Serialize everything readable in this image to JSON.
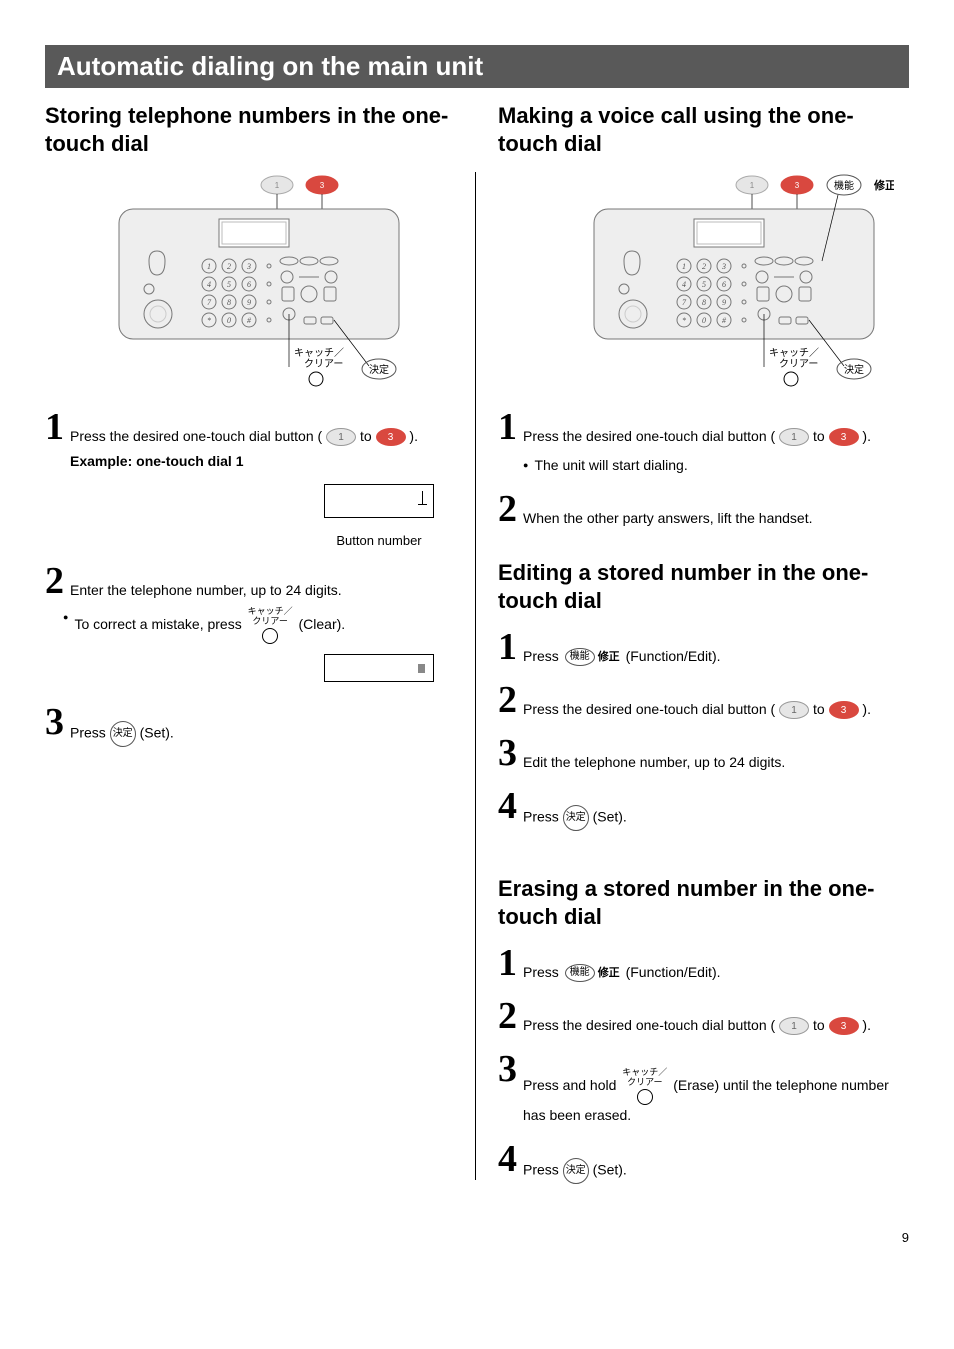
{
  "pageNumber": "9",
  "headerTitle": "Automatic dialing on the main unit",
  "left": {
    "title": "Storing telephone numbers in the one-touch dial",
    "step1": "Press the desired one-touch dial button (",
    "step1_close": ").",
    "example": "Example: one-touch dial 1",
    "displayCaption": "Button number",
    "step2": "Enter the telephone number, up to 24 digits.",
    "correct": "To correct a mistake, press",
    "correctAfter": "(Clear).",
    "step3": "Press",
    "setLabel": "(Set).",
    "to": "to"
  },
  "right": {
    "making": {
      "title": "Making a voice call using the one-touch dial",
      "step1": "Press the desired one-touch dial button (",
      "step1_close": ").",
      "bullet": "The unit will start dialing.",
      "step2": "When the other party answers, lift the handset."
    },
    "editing": {
      "title": "Editing a stored number in the one-touch dial",
      "step1a": "Press",
      "step1b": "(Function/Edit).",
      "step2": "Press the desired one-touch dial button (",
      "step2_close": ").",
      "step3": "Edit the telephone number, up to 24 digits.",
      "step4a": "Press",
      "step4b": "(Set)."
    },
    "erasing": {
      "title": "Erasing a stored number in the one-touch dial",
      "step1a": "Press",
      "step1b": "(Function/Edit).",
      "step2": "Press the desired one-touch dial button (",
      "step2_close": ").",
      "step3a": "Press and hold",
      "step3b": "(Erase) until the telephone number has been erased.",
      "step4a": "Press",
      "step4b": "(Set)."
    }
  },
  "labels": {
    "to": "to",
    "clearJP_top": "キャッチ／",
    "clearJP_bot": "クリアー",
    "setJP": "決定",
    "funcJP": "機能",
    "editJP": "修正",
    "otd1": "1",
    "otd3": "3"
  }
}
